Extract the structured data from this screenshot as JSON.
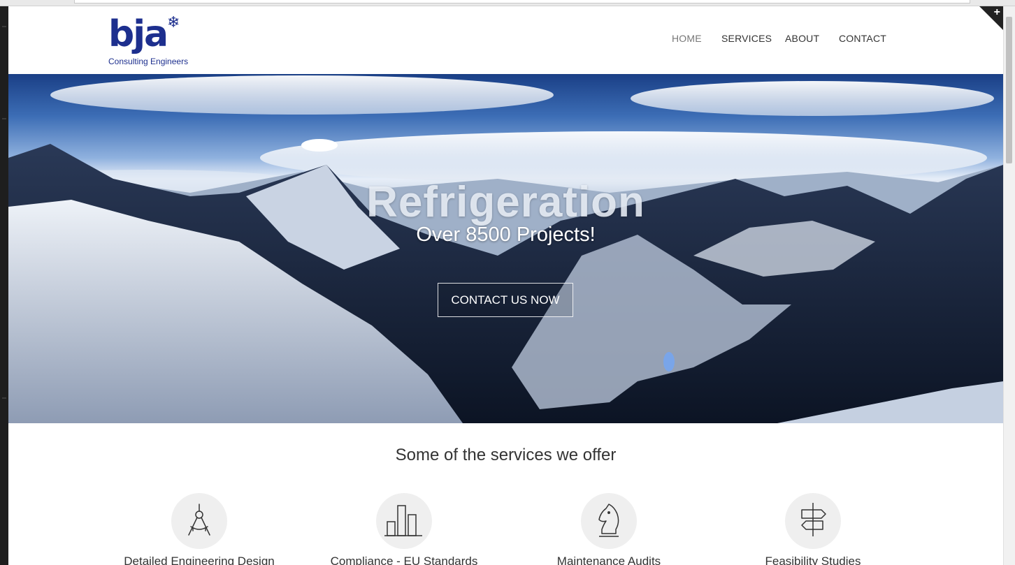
{
  "logo": {
    "text": "bja",
    "flake": "❄",
    "subtitle": "Consulting Engineers"
  },
  "nav": [
    {
      "label": "HOME",
      "active": true
    },
    {
      "label": "SERVICES",
      "active": false
    },
    {
      "label": "ABOUT",
      "active": false
    },
    {
      "label": "CONTACT",
      "active": false
    }
  ],
  "corner_icon": "+",
  "hero": {
    "title": "Refrigeration",
    "subtitle": "Over 8500 Projects!",
    "button": "CONTACT US NOW"
  },
  "services": {
    "heading": "Some of the services we offer",
    "items": [
      {
        "label": "Detailed Engineering Design",
        "icon": "compass-icon"
      },
      {
        "label": "Compliance - EU Standards",
        "icon": "bar-chart-icon"
      },
      {
        "label": "Maintenance Audits",
        "icon": "chess-knight-icon"
      },
      {
        "label": "Feasibility Studies",
        "icon": "signpost-icon"
      }
    ]
  },
  "colors": {
    "brand": "#1d2f8e",
    "text": "#333333",
    "nav_active": "#777777"
  }
}
